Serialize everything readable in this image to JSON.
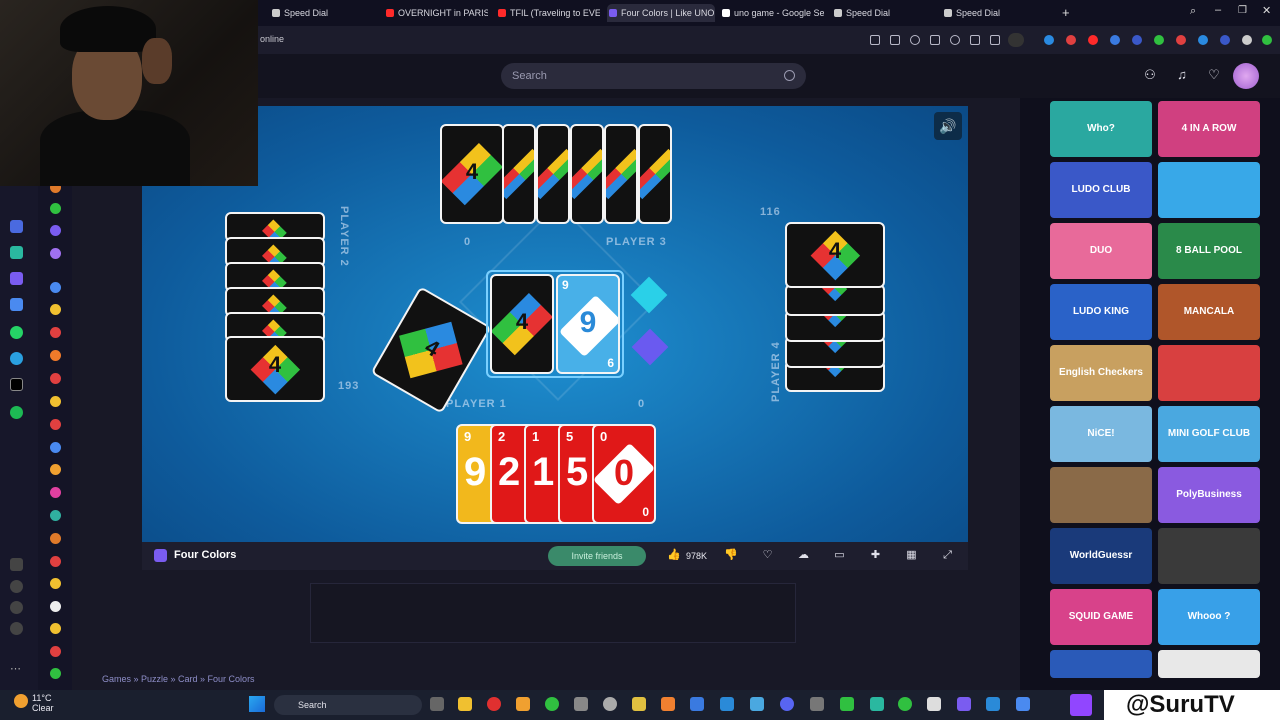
{
  "browser": {
    "tabs": [
      {
        "label": "Speed Dial",
        "fav": "#bbbbbb"
      },
      {
        "label": "OVERNIGHT in PARIS CAT",
        "fav": "#ff2a2a"
      },
      {
        "label": "TFIL (Traveling to EVERY C",
        "fav": "#ff2a2a"
      },
      {
        "label": "Four Colors | Like UNO",
        "fav": "#7a5cf0"
      },
      {
        "label": "uno game - Google Searc",
        "fav": "#ffffff"
      },
      {
        "label": "Speed Dial",
        "fav": "#bbbbbb"
      },
      {
        "label": "Speed Dial",
        "fav": "#bbbbbb"
      }
    ],
    "url": "online"
  },
  "site": {
    "search_placeholder": "Search"
  },
  "game": {
    "title": "Four Colors",
    "players": {
      "p2_label": "PLAYER 2",
      "p2_score": "193",
      "p3_label": "PLAYER 3",
      "p3_score": "0",
      "p4_label": "PLAYER 4",
      "p4_score": "116",
      "p1_label": "PLAYER 1",
      "p1_score": "0"
    },
    "deck_card": "4",
    "discard_black": "4",
    "discard_blue": "9",
    "discard_blue_corner_top": "9",
    "discard_blue_corner_bottom": "6",
    "hand": [
      {
        "value": "9",
        "color": "#f2b81c"
      },
      {
        "value": "2",
        "color": "#e01818"
      },
      {
        "value": "1",
        "color": "#e01818"
      },
      {
        "value": "5",
        "color": "#e01818"
      },
      {
        "value": "0",
        "color": "#e01818"
      }
    ],
    "hand_last_bottom": "0",
    "top_card_value": "4",
    "left_card_value": "4",
    "right_card_value": "4"
  },
  "toolbar": {
    "invite_label": "Invite friends",
    "likes": "978K"
  },
  "breadcrumb": "Games » Puzzle » Card » Four Colors",
  "thumbs": [
    {
      "label": "Who?",
      "bg": "#2aa8a0"
    },
    {
      "label": "4 IN A ROW",
      "bg": "#d04080"
    },
    {
      "label": "LUDO CLUB",
      "bg": "#3a58c8"
    },
    {
      "label": "",
      "bg": "#38a8e8"
    },
    {
      "label": "DUO",
      "bg": "#e86a9a"
    },
    {
      "label": "8 BALL POOL",
      "bg": "#2a8a4a"
    },
    {
      "label": "LUDO KING",
      "bg": "#2a62c8"
    },
    {
      "label": "MANCALA",
      "bg": "#b0562a"
    },
    {
      "label": "English Checkers Free",
      "bg": "#c8a060"
    },
    {
      "label": "",
      "bg": "#d84040"
    },
    {
      "label": "NiCE!",
      "bg": "#7ab8e0"
    },
    {
      "label": "MINI GOLF CLUB",
      "bg": "#4aa8e0"
    },
    {
      "label": "",
      "bg": "#8a6a48"
    },
    {
      "label": "PolyBusiness",
      "bg": "#8a5ae0"
    },
    {
      "label": "WorldGuessr",
      "bg": "#1a3a7a"
    },
    {
      "label": "",
      "bg": "#3a3a3a"
    },
    {
      "label": "SQUID GAME ONLINE",
      "bg": "#d8428a"
    },
    {
      "label": "Whooo ?",
      "bg": "#38a0e8"
    },
    {
      "label": "",
      "bg": "#2a5ab8"
    },
    {
      "label": "",
      "bg": "#e8e8e8"
    }
  ],
  "taskbar": {
    "temperature": "11°C",
    "condition": "Clear",
    "search": "Search",
    "handle": "@SuruTV"
  }
}
